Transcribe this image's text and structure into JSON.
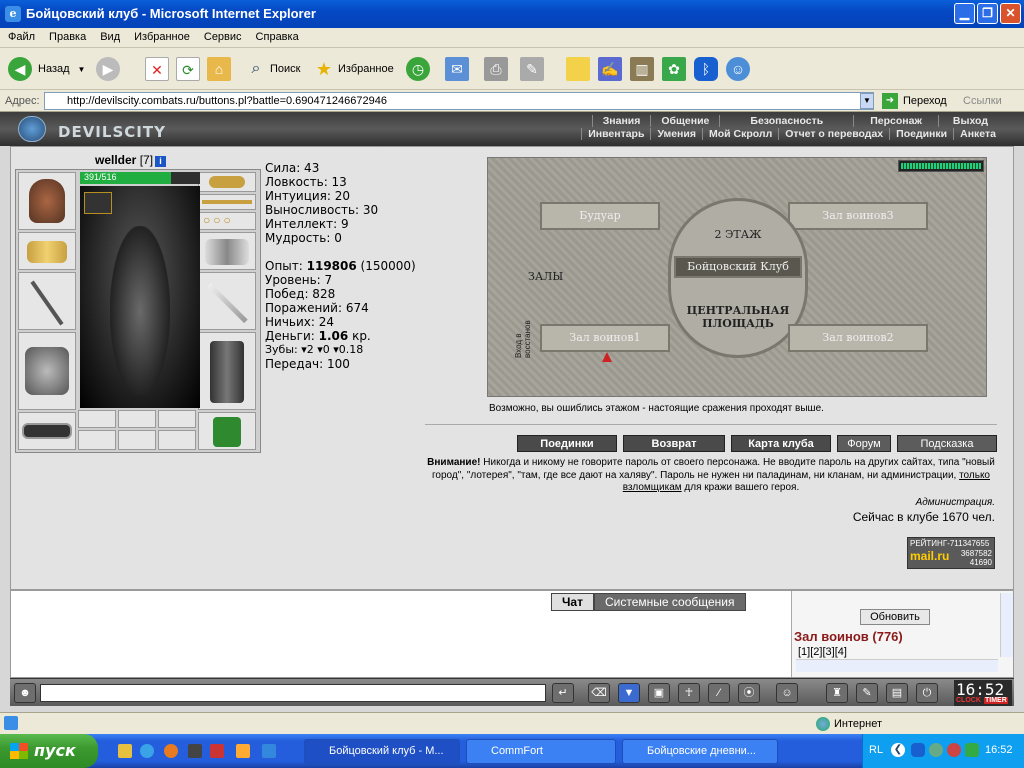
{
  "window": {
    "title": "Бойцовский клуб - Microsoft Internet Explorer"
  },
  "menu": [
    "Файл",
    "Правка",
    "Вид",
    "Избранное",
    "Сервис",
    "Справка"
  ],
  "toolbar": {
    "back": "Назад",
    "search": "Поиск",
    "favorites": "Избранное"
  },
  "address": {
    "label": "Адрес:",
    "url": "http://devilscity.combats.ru/buttons.pl?battle=0.690471246672946",
    "go": "Переход",
    "links": "Ссылки"
  },
  "site": {
    "logo": "DEVILSCITY"
  },
  "nav": {
    "row1": [
      "Знания",
      "Общение",
      "Безопасность",
      "Персонаж",
      "Выход"
    ],
    "row2": [
      "Инвентарь",
      "Умения",
      "Мой Скролл",
      "Отчет о переводах",
      "Поединки",
      "Анкета"
    ]
  },
  "character": {
    "name": "wellder",
    "level": "[7]",
    "hp": "391/516",
    "hp_fraction": 0.758
  },
  "stats": [
    "Сила: 43",
    "Ловкость: 13",
    "Интуиция: 20",
    "Выносливость: 30",
    "Интеллект: 9",
    "Мудрость: 0"
  ],
  "progress": {
    "exp_label": "Опыт: ",
    "exp": "119806",
    "exp_next": " (150000)",
    "lines": [
      "Уровень: 7",
      "Побед: 828",
      "Поражений: 674",
      "Ничьих: 24"
    ],
    "money_label": "Деньги: ",
    "money": "1.06",
    "money_unit": " кр.",
    "teeth": "Зубы: ▾2 ▾0 ▾0.18",
    "transfers": "Передач: 100"
  },
  "map": {
    "rooms": [
      "Будуар",
      "Зал воинов3",
      "2 ЭТАЖ",
      "Бойцовский Клуб",
      "ЗАЛЫ",
      "ЦЕНТРАЛЬНАЯ ПЛОЩАДЬ",
      "Зал воинов1",
      "Зал воинов2",
      "Вход в восстанов"
    ],
    "hint": "Возможно, вы ошиблись этажом - настоящие сражения проходят выше."
  },
  "buttons": [
    "Поединки",
    "Возврат",
    "Карта клуба",
    "Форум",
    "Подсказка"
  ],
  "warning": {
    "bold": "Внимание!",
    "text": " Никогда и никому не говорите пароль от своего персонажа. Не вводите пароль на других сайтах, типа \"новый город\", \"лотерея\", \"там, где все дают на халяву\". Пароль не нужен ни паладинам, ни кланам, ни администрации, ",
    "link": "только взломщикам",
    "tail": " для кражи вашего героя."
  },
  "admin_sign": "Администрация.",
  "online": "Сейчас в клубе 1670 чел.",
  "counter": {
    "line1": "РЕЙТИНГ-711347655",
    "brand": "mail.ru",
    "n1": "3687582",
    "n2": "41690"
  },
  "chat": {
    "tabs": [
      "Чат",
      "Системные сообщения"
    ],
    "refresh": "Обновить",
    "room": "Зал воинов (776)",
    "pages": "[1][2][3][4]"
  },
  "clock": {
    "time": "16:52",
    "label": "CLOCK",
    "timer": "TIMER"
  },
  "status": {
    "zone": "Интернет"
  },
  "taskbar": {
    "start": "пуск",
    "tasks": [
      "Бойцовский клуб - М...",
      "CommFort",
      "Бойцовские дневни..."
    ],
    "lang": "RL",
    "time": "16:52"
  }
}
